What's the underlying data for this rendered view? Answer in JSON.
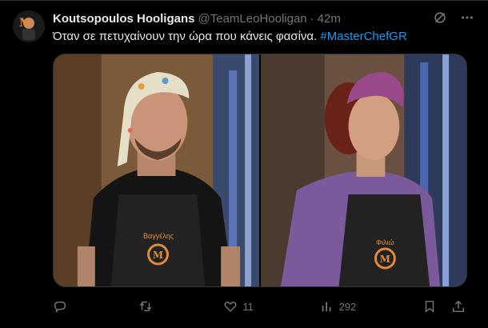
{
  "author": {
    "display_name": "Koutsopoulos Hooligans",
    "handle": "@TeamLeoHooligan",
    "separator": "·",
    "time": "42m"
  },
  "tweet": {
    "text": "Όταν σε πετυχαίνουν την ώρα που κάνεις φασίνα. ",
    "hashtag": "#MasterChefGR"
  },
  "media": {
    "left_apron_name": "Βαγγέλης",
    "right_apron_name": "Φιλιώ"
  },
  "actions": {
    "reply_count": "",
    "retweet_count": "",
    "like_count": "11",
    "view_count": "292"
  },
  "colors": {
    "background": "#000000",
    "text": "#e7e9ea",
    "muted": "#71767b",
    "link": "#1d9bf0"
  }
}
